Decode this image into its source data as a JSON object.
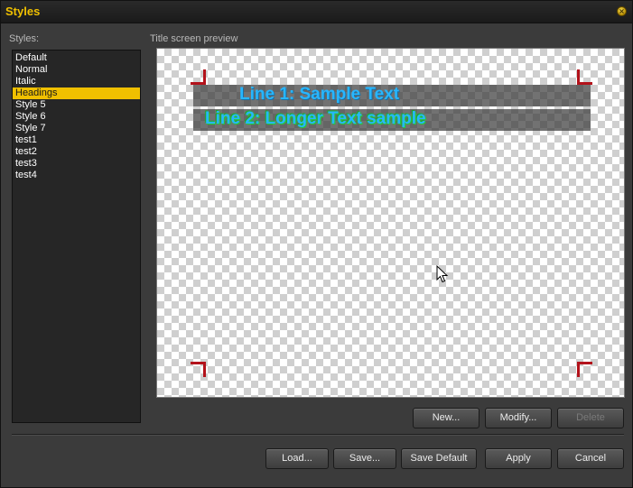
{
  "window": {
    "title": "Styles",
    "accent_color": "#f0c000"
  },
  "styles_label": "Styles:",
  "styles": [
    {
      "label": "Default",
      "selected": false
    },
    {
      "label": "Normal",
      "selected": false
    },
    {
      "label": "Italic",
      "selected": false
    },
    {
      "label": "Headings",
      "selected": true
    },
    {
      "label": "Style 5",
      "selected": false
    },
    {
      "label": "Style 6",
      "selected": false
    },
    {
      "label": "Style 7",
      "selected": false
    },
    {
      "label": "test1",
      "selected": false
    },
    {
      "label": "test2",
      "selected": false
    },
    {
      "label": "test3",
      "selected": false
    },
    {
      "label": "test4",
      "selected": false
    }
  ],
  "preview": {
    "label": "Title screen preview",
    "line1": "Line 1: Sample Text",
    "line2": "Line 2: Longer Text sample",
    "text_color": "#27b6ff",
    "line2_outline_color": "#27c93a",
    "safe_area_marker_color": "#b3121b"
  },
  "style_buttons": {
    "new": "New...",
    "modify": "Modify...",
    "delete": "Delete"
  },
  "footer_buttons": {
    "load": "Load...",
    "save": "Save...",
    "save_default": "Save Default",
    "apply": "Apply",
    "cancel": "Cancel"
  },
  "icons": {
    "close": "close-icon",
    "cursor": "mouse-cursor-icon"
  }
}
